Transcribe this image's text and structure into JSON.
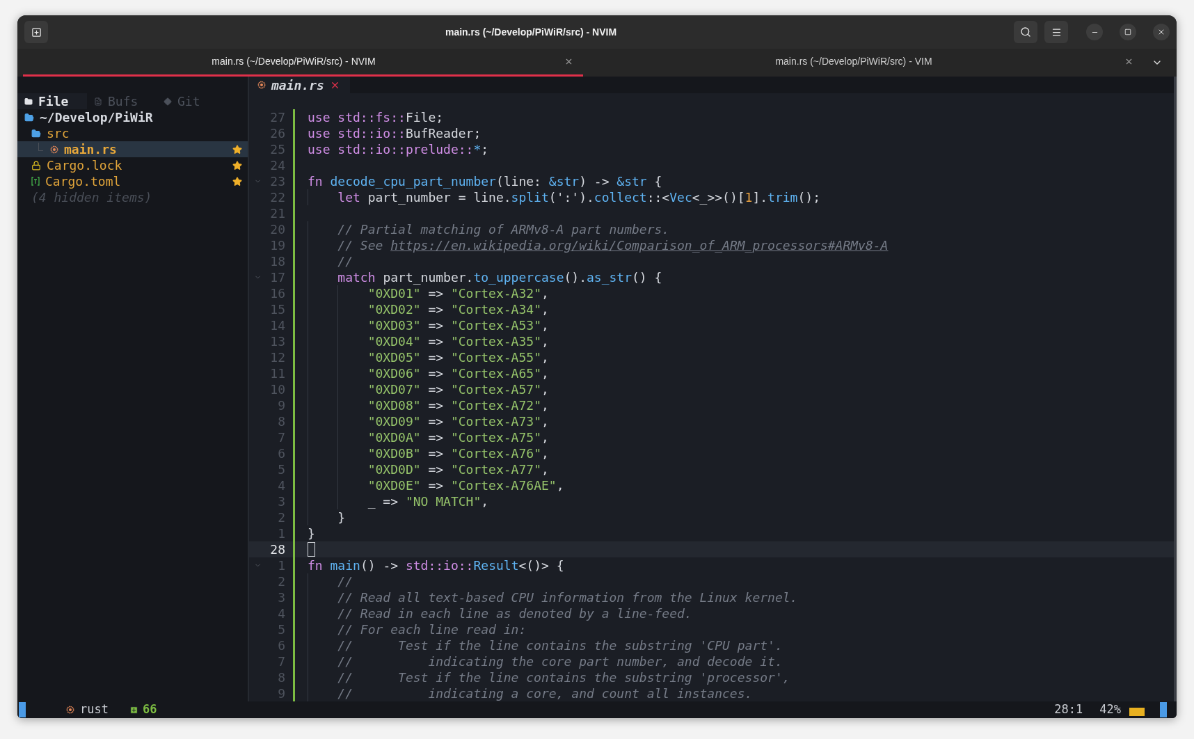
{
  "window": {
    "title": "main.rs (~/Develop/PiWiR/src) - NVIM"
  },
  "tabs": [
    {
      "label": "main.rs (~/Develop/PiWiR/src) - NVIM",
      "selected": true
    },
    {
      "label": "main.rs (~/Develop/PiWiR/src) - VIM",
      "selected": false
    }
  ],
  "explorer": {
    "tabs": [
      {
        "label": "File",
        "selected": true
      },
      {
        "label": "Bufs",
        "selected": false
      },
      {
        "label": "Git",
        "selected": false
      }
    ],
    "tree": [
      {
        "name": "~/Develop/PiWiR",
        "kind": "folder",
        "expanded": true,
        "selected": false,
        "modified": false,
        "children": [
          {
            "name": "src",
            "kind": "folder",
            "expanded": true,
            "selected": false,
            "modified": false,
            "children": [
              {
                "name": "main.rs",
                "kind": "rust",
                "selected": true,
                "modified": true
              }
            ]
          },
          {
            "name": "Cargo.lock",
            "kind": "lock",
            "selected": false,
            "modified": true
          },
          {
            "name": "Cargo.toml",
            "kind": "toml",
            "selected": false,
            "modified": true
          }
        ]
      }
    ],
    "hidden_note": "(4 hidden items)"
  },
  "buffer_tab": {
    "label": "main.rs"
  },
  "lines": [
    {
      "number": "27",
      "tokens": [
        {
          "kind": "kw",
          "text": "use"
        },
        {
          "kind": "module",
          "text": " std::fs::"
        },
        {
          "kind": "plain",
          "text": "File;"
        }
      ]
    },
    {
      "number": "26",
      "tokens": [
        {
          "kind": "kw",
          "text": "use"
        },
        {
          "kind": "module",
          "text": " std::io::"
        },
        {
          "kind": "plain",
          "text": "BufReader;"
        }
      ]
    },
    {
      "number": "25",
      "tokens": [
        {
          "kind": "kw",
          "text": "use"
        },
        {
          "kind": "module",
          "text": " std::io::prelude::"
        },
        {
          "kind": "type",
          "text": "*"
        },
        {
          "kind": "plain",
          "text": ";"
        }
      ]
    },
    {
      "number": "24"
    },
    {
      "number": "23",
      "foldable": true,
      "tokens": [
        {
          "kind": "kw",
          "text": "fn"
        },
        {
          "kind": "func",
          "text": " decode_cpu_part_number"
        },
        {
          "kind": "plain",
          "text": "(line: "
        },
        {
          "kind": "type",
          "text": "&str"
        },
        {
          "kind": "plain",
          "text": ") -> "
        },
        {
          "kind": "type",
          "text": "&str"
        },
        {
          "kind": "plain",
          "text": " {"
        }
      ]
    },
    {
      "number": "22",
      "tokens": [
        {
          "kind": "kw",
          "text": "    let"
        },
        {
          "kind": "plain",
          "text": " part_number = line."
        },
        {
          "kind": "func",
          "text": "split"
        },
        {
          "kind": "plain",
          "text": "(':')."
        },
        {
          "kind": "func",
          "text": "collect"
        },
        {
          "kind": "plain",
          "text": "::<"
        },
        {
          "kind": "type",
          "text": "Vec"
        },
        {
          "kind": "plain",
          "text": "<_>>()["
        },
        {
          "kind": "num",
          "text": "1"
        },
        {
          "kind": "plain",
          "text": "]."
        },
        {
          "kind": "func",
          "text": "trim"
        },
        {
          "kind": "plain",
          "text": "();"
        }
      ]
    },
    {
      "number": "21"
    },
    {
      "number": "20",
      "tokens": [
        {
          "kind": "comment",
          "text": "    // Partial matching of ARMv8-A part numbers."
        }
      ]
    },
    {
      "number": "19",
      "tokens": [
        {
          "kind": "comment",
          "text": "    // See "
        },
        {
          "kind": "link",
          "text": "https://en.wikipedia.org/wiki/Comparison_of_ARM_processors#ARMv8-A"
        }
      ]
    },
    {
      "number": "18",
      "tokens": [
        {
          "kind": "comment",
          "text": "    //"
        }
      ]
    },
    {
      "number": "17",
      "foldable": true,
      "tokens": [
        {
          "kind": "kw",
          "text": "    match"
        },
        {
          "kind": "plain",
          "text": " part_number."
        },
        {
          "kind": "func",
          "text": "to_uppercase"
        },
        {
          "kind": "plain",
          "text": "()."
        },
        {
          "kind": "func",
          "text": "as_str"
        },
        {
          "kind": "plain",
          "text": "() {"
        }
      ]
    },
    {
      "number": "16",
      "tokens": [
        {
          "kind": "str",
          "text": "        \"0XD01\""
        },
        {
          "kind": "plain",
          "text": " => "
        },
        {
          "kind": "str",
          "text": "\"Cortex-A32\""
        },
        {
          "kind": "plain",
          "text": ","
        }
      ]
    },
    {
      "number": "15",
      "tokens": [
        {
          "kind": "str",
          "text": "        \"0XD02\""
        },
        {
          "kind": "plain",
          "text": " => "
        },
        {
          "kind": "str",
          "text": "\"Cortex-A34\""
        },
        {
          "kind": "plain",
          "text": ","
        }
      ]
    },
    {
      "number": "14",
      "tokens": [
        {
          "kind": "str",
          "text": "        \"0XD03\""
        },
        {
          "kind": "plain",
          "text": " => "
        },
        {
          "kind": "str",
          "text": "\"Cortex-A53\""
        },
        {
          "kind": "plain",
          "text": ","
        }
      ]
    },
    {
      "number": "13",
      "tokens": [
        {
          "kind": "str",
          "text": "        \"0XD04\""
        },
        {
          "kind": "plain",
          "text": " => "
        },
        {
          "kind": "str",
          "text": "\"Cortex-A35\""
        },
        {
          "kind": "plain",
          "text": ","
        }
      ]
    },
    {
      "number": "12",
      "tokens": [
        {
          "kind": "str",
          "text": "        \"0XD05\""
        },
        {
          "kind": "plain",
          "text": " => "
        },
        {
          "kind": "str",
          "text": "\"Cortex-A55\""
        },
        {
          "kind": "plain",
          "text": ","
        }
      ]
    },
    {
      "number": "11",
      "tokens": [
        {
          "kind": "str",
          "text": "        \"0XD06\""
        },
        {
          "kind": "plain",
          "text": " => "
        },
        {
          "kind": "str",
          "text": "\"Cortex-A65\""
        },
        {
          "kind": "plain",
          "text": ","
        }
      ]
    },
    {
      "number": "10",
      "tokens": [
        {
          "kind": "str",
          "text": "        \"0XD07\""
        },
        {
          "kind": "plain",
          "text": " => "
        },
        {
          "kind": "str",
          "text": "\"Cortex-A57\""
        },
        {
          "kind": "plain",
          "text": ","
        }
      ]
    },
    {
      "number": "9",
      "tokens": [
        {
          "kind": "str",
          "text": "        \"0XD08\""
        },
        {
          "kind": "plain",
          "text": " => "
        },
        {
          "kind": "str",
          "text": "\"Cortex-A72\""
        },
        {
          "kind": "plain",
          "text": ","
        }
      ]
    },
    {
      "number": "8",
      "tokens": [
        {
          "kind": "str",
          "text": "        \"0XD09\""
        },
        {
          "kind": "plain",
          "text": " => "
        },
        {
          "kind": "str",
          "text": "\"Cortex-A73\""
        },
        {
          "kind": "plain",
          "text": ","
        }
      ]
    },
    {
      "number": "7",
      "tokens": [
        {
          "kind": "str",
          "text": "        \"0XD0A\""
        },
        {
          "kind": "plain",
          "text": " => "
        },
        {
          "kind": "str",
          "text": "\"Cortex-A75\""
        },
        {
          "kind": "plain",
          "text": ","
        }
      ]
    },
    {
      "number": "6",
      "tokens": [
        {
          "kind": "str",
          "text": "        \"0XD0B\""
        },
        {
          "kind": "plain",
          "text": " => "
        },
        {
          "kind": "str",
          "text": "\"Cortex-A76\""
        },
        {
          "kind": "plain",
          "text": ","
        }
      ]
    },
    {
      "number": "5",
      "tokens": [
        {
          "kind": "str",
          "text": "        \"0XD0D\""
        },
        {
          "kind": "plain",
          "text": " => "
        },
        {
          "kind": "str",
          "text": "\"Cortex-A77\""
        },
        {
          "kind": "plain",
          "text": ","
        }
      ]
    },
    {
      "number": "4",
      "tokens": [
        {
          "kind": "str",
          "text": "        \"0XD0E\""
        },
        {
          "kind": "plain",
          "text": " => "
        },
        {
          "kind": "str",
          "text": "\"Cortex-A76AE\""
        },
        {
          "kind": "plain",
          "text": ","
        }
      ]
    },
    {
      "number": "3",
      "tokens": [
        {
          "kind": "plain",
          "text": "        _ => "
        },
        {
          "kind": "str",
          "text": "\"NO MATCH\""
        },
        {
          "kind": "plain",
          "text": ","
        }
      ]
    },
    {
      "number": "2",
      "tokens": [
        {
          "kind": "plain",
          "text": "    }"
        }
      ]
    },
    {
      "number": "1",
      "tokens": [
        {
          "kind": "plain",
          "text": "}"
        }
      ]
    },
    {
      "number": "28",
      "current": true
    },
    {
      "number": "1",
      "foldable": true,
      "tokens": [
        {
          "kind": "kw",
          "text": "fn"
        },
        {
          "kind": "func",
          "text": " main"
        },
        {
          "kind": "plain",
          "text": "() -> "
        },
        {
          "kind": "module",
          "text": "std::io::"
        },
        {
          "kind": "type",
          "text": "Result"
        },
        {
          "kind": "plain",
          "text": "<()> {"
        }
      ]
    },
    {
      "number": "2",
      "tokens": [
        {
          "kind": "comment",
          "text": "    //"
        }
      ]
    },
    {
      "number": "3",
      "tokens": [
        {
          "kind": "comment",
          "text": "    // Read all text-based CPU information from the Linux kernel."
        }
      ]
    },
    {
      "number": "4",
      "tokens": [
        {
          "kind": "comment",
          "text": "    // Read in each line as denoted by a line-feed."
        }
      ]
    },
    {
      "number": "5",
      "tokens": [
        {
          "kind": "comment",
          "text": "    // For each line read in:"
        }
      ]
    },
    {
      "number": "6",
      "tokens": [
        {
          "kind": "comment",
          "text": "    //      Test if the line contains the substring 'CPU part'."
        }
      ]
    },
    {
      "number": "7",
      "tokens": [
        {
          "kind": "comment",
          "text": "    //          indicating the core part number, and decode it."
        }
      ]
    },
    {
      "number": "8",
      "tokens": [
        {
          "kind": "comment",
          "text": "    //      Test if the line contains the substring 'processor',"
        }
      ]
    },
    {
      "number": "9",
      "tokens": [
        {
          "kind": "comment",
          "text": "    //          indicating a core, and count all instances."
        }
      ]
    }
  ],
  "status_bar": {
    "filetype": "rust",
    "added": "66",
    "position": "28:1",
    "percent": "42%"
  }
}
